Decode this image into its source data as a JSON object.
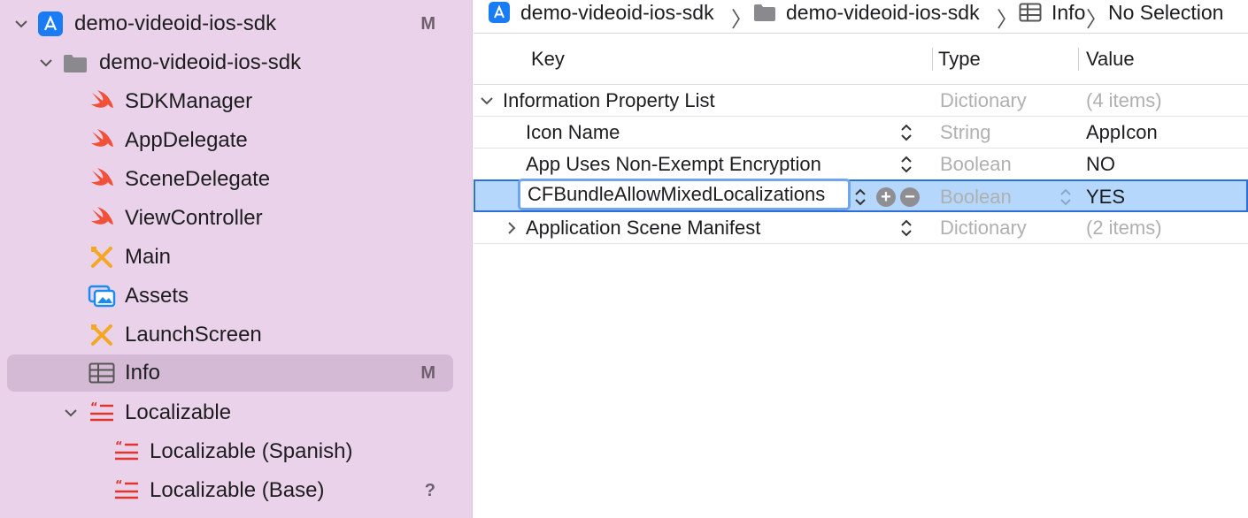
{
  "sidebar": {
    "items": [
      {
        "label": "demo-videoid-ios-sdk",
        "icon": "app-project-icon",
        "badge": "M",
        "disclosure": "expanded"
      },
      {
        "label": "demo-videoid-ios-sdk",
        "icon": "folder-icon",
        "badge": "",
        "disclosure": "expanded"
      },
      {
        "label": "SDKManager",
        "icon": "swift-file-icon",
        "badge": ""
      },
      {
        "label": "AppDelegate",
        "icon": "swift-file-icon",
        "badge": ""
      },
      {
        "label": "SceneDelegate",
        "icon": "swift-file-icon",
        "badge": ""
      },
      {
        "label": "ViewController",
        "icon": "swift-file-icon",
        "badge": ""
      },
      {
        "label": "Main",
        "icon": "storyboard-icon",
        "badge": ""
      },
      {
        "label": "Assets",
        "icon": "asset-catalog-icon",
        "badge": ""
      },
      {
        "label": "LaunchScreen",
        "icon": "storyboard-icon",
        "badge": ""
      },
      {
        "label": "Info",
        "icon": "plist-table-icon",
        "badge": "M",
        "selected": true
      },
      {
        "label": "Localizable",
        "icon": "strings-file-icon",
        "badge": "",
        "disclosure": "expanded"
      },
      {
        "label": "Localizable (Spanish)",
        "icon": "strings-file-icon",
        "badge": ""
      },
      {
        "label": "Localizable (Base)",
        "icon": "strings-file-icon",
        "badge": "?"
      }
    ]
  },
  "jumpbar": {
    "items": [
      {
        "label": "demo-videoid-ios-sdk",
        "icon": "app-project-icon"
      },
      {
        "label": "demo-videoid-ios-sdk",
        "icon": "folder-icon"
      },
      {
        "label": "Info",
        "icon": "plist-table-icon"
      },
      {
        "label": "No Selection",
        "icon": ""
      }
    ]
  },
  "plist": {
    "headers": {
      "key": "Key",
      "type": "Type",
      "value": "Value"
    },
    "rows": [
      {
        "key": "Information Property List",
        "type": "Dictionary",
        "value": "(4 items)"
      },
      {
        "key": "Icon Name",
        "type": "String",
        "value": "AppIcon"
      },
      {
        "key": "App Uses Non-Exempt Encryption",
        "type": "Boolean",
        "value": "NO"
      },
      {
        "key": "CFBundleAllowMixedLocalizations",
        "type": "Boolean",
        "value": "YES"
      },
      {
        "key": "Application Scene Manifest",
        "type": "Dictionary",
        "value": "(2 items)"
      }
    ]
  },
  "colors": {
    "sidebar_bg": "#ead3ea",
    "selection": "#b4d7fb",
    "swift": "#f05138",
    "accent": "#2d6fd6"
  }
}
